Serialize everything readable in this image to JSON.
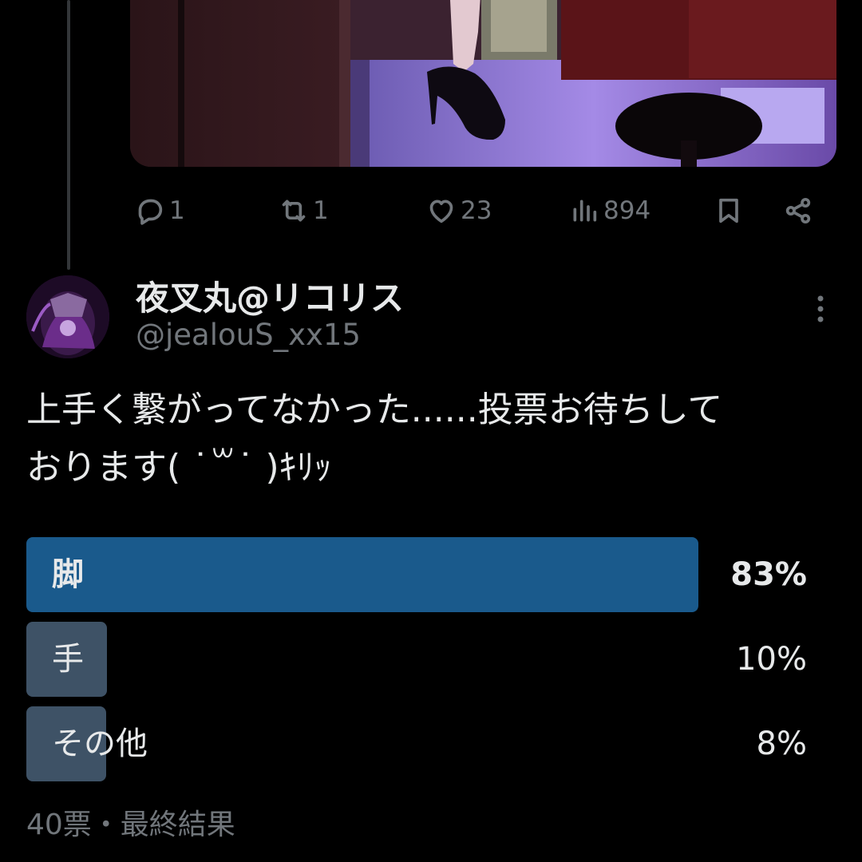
{
  "colors": {
    "background": "#000000",
    "text_primary": "#e7e9ea",
    "text_secondary": "#71767b",
    "poll_winner": "#1a5a8c",
    "poll_other": "#3e5266"
  },
  "previous_tweet": {
    "media": {
      "description_icon": "image"
    },
    "actions": {
      "reply": {
        "icon": "reply-icon",
        "count": "1"
      },
      "retweet": {
        "icon": "retweet-icon",
        "count": "1"
      },
      "like": {
        "icon": "heart-icon",
        "count": "23"
      },
      "views": {
        "icon": "views-icon",
        "count": "894"
      },
      "bookmark": {
        "icon": "bookmark-icon"
      },
      "share": {
        "icon": "share-icon"
      }
    }
  },
  "tweet": {
    "display_name": "夜叉丸@リコリス",
    "handle": "@jealouS_xx15",
    "text": "上手く繋がってなかった......投票お待ちして\nおります( ˙꒳˙ )ｷﾘｯ",
    "poll": {
      "options": [
        {
          "label": "脚",
          "percent": "83%",
          "fraction": 0.83,
          "winner": true
        },
        {
          "label": "手",
          "percent": "10%",
          "fraction": 0.1,
          "winner": false
        },
        {
          "label": "その他",
          "percent": "8%",
          "fraction": 0.08,
          "winner": false
        }
      ],
      "footer": "40票・最終結果"
    }
  }
}
